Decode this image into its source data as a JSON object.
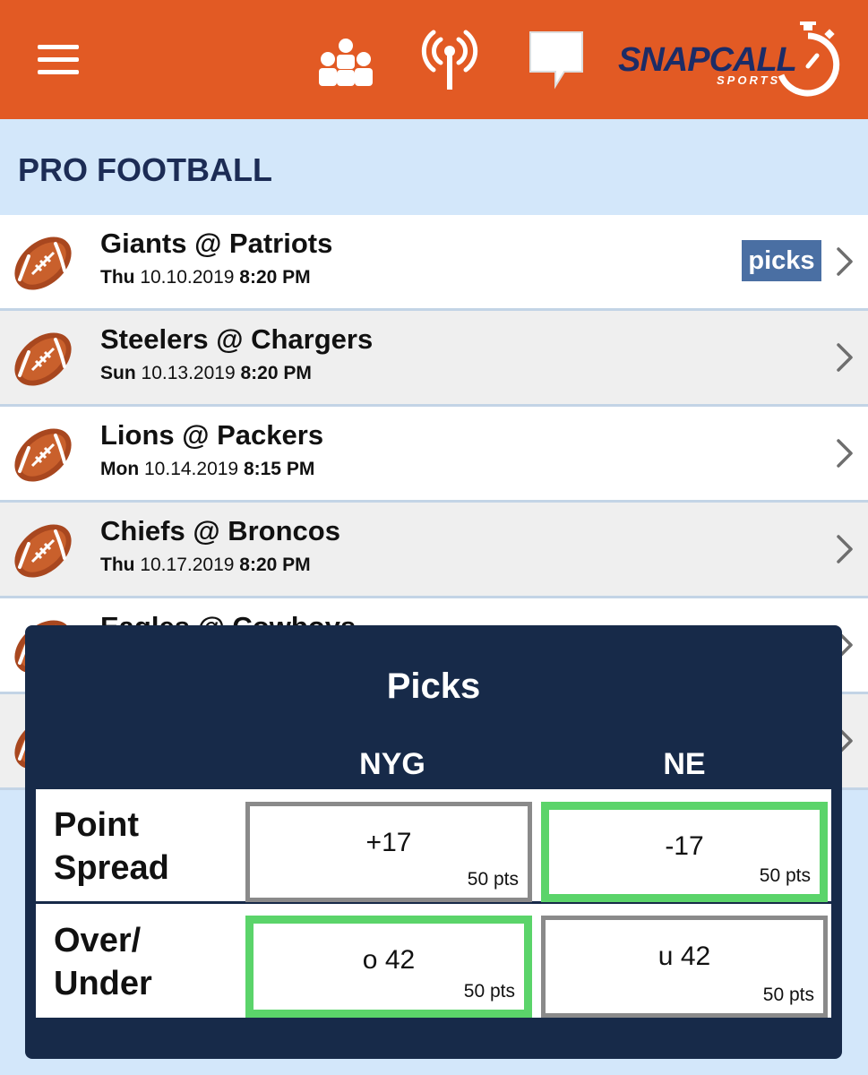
{
  "header": {
    "logo_text": "SNAPCALL",
    "logo_sub": "SPORTS",
    "colors": {
      "bar": "#e25a24",
      "logo": "#1c2c66"
    },
    "icons": [
      "menu-icon",
      "people-icon",
      "broadcast-icon",
      "chat-icon"
    ]
  },
  "section": {
    "title": "PRO FOOTBALL"
  },
  "games": [
    {
      "teams": "Giants @ Patriots",
      "day": "Thu",
      "date": "10.10.2019",
      "time": "8:20 PM",
      "badge": "picks"
    },
    {
      "teams": "Steelers @ Chargers",
      "day": "Sun",
      "date": "10.13.2019",
      "time": "8:20 PM"
    },
    {
      "teams": "Lions @ Packers",
      "day": "Mon",
      "date": "10.14.2019",
      "time": "8:15 PM"
    },
    {
      "teams": "Chiefs @ Broncos",
      "day": "Thu",
      "date": "10.17.2019",
      "time": "8:20 PM"
    },
    {
      "teams": "Eagles @ Cowboys",
      "day": "",
      "date": "",
      "time": ""
    },
    {
      "teams": "",
      "day": "",
      "date": "",
      "time": ""
    }
  ],
  "picks_modal": {
    "title": "Picks",
    "columns": [
      "NYG",
      "NE"
    ],
    "rows": [
      {
        "label_line1": "Point",
        "label_line2": "Spread",
        "cells": [
          {
            "value": "+17",
            "pts": "50 pts",
            "selected": false
          },
          {
            "value": "-17",
            "pts": "50 pts",
            "selected": true
          }
        ]
      },
      {
        "label_line1": "Over/",
        "label_line2": "Under",
        "cells": [
          {
            "value": "o 42",
            "pts": "50 pts",
            "selected": true
          },
          {
            "value": "u 42",
            "pts": "50 pts",
            "selected": false
          }
        ]
      }
    ],
    "colors": {
      "background": "#172a49",
      "selected": "#5bd46a",
      "unselected": "#8a8a8a"
    }
  }
}
